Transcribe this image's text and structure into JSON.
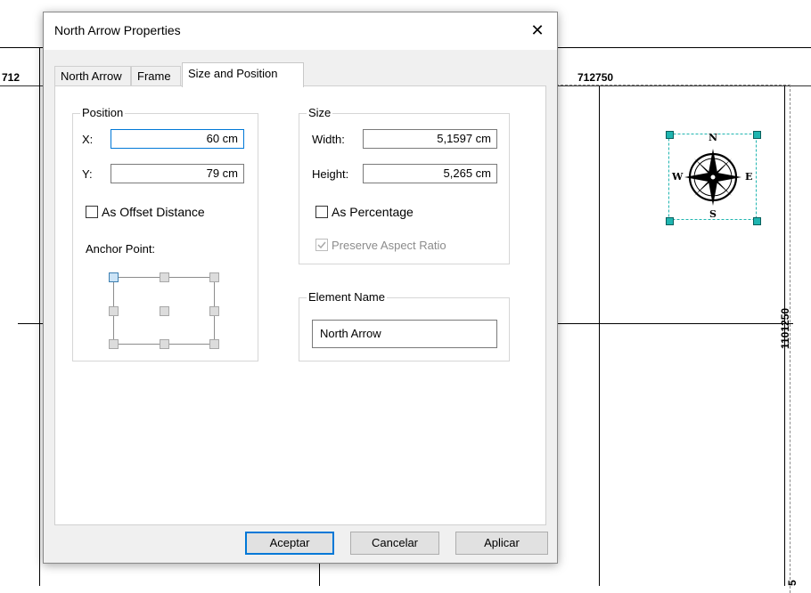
{
  "map": {
    "label_left": "712",
    "label_top": "712750",
    "label_right": "1101250",
    "label_bottom": "5"
  },
  "north_arrow_graphic": {
    "n": "N",
    "s": "S",
    "e": "E",
    "w": "W"
  },
  "dialog": {
    "title": "North Arrow Properties",
    "close_glyph": "✕",
    "tabs": [
      {
        "label": "North Arrow",
        "active": false
      },
      {
        "label": "Frame",
        "active": false
      },
      {
        "label": "Size and Position",
        "active": true
      }
    ],
    "position": {
      "group_label": "Position",
      "x_label": "X:",
      "x_value": "60 cm",
      "y_label": "Y:",
      "y_value": "79 cm",
      "offset_label": "As Offset Distance",
      "offset_checked": false,
      "anchor_label": "Anchor Point:"
    },
    "size": {
      "group_label": "Size",
      "width_label": "Width:",
      "width_value": "5,1597 cm",
      "height_label": "Height:",
      "height_value": "5,265 cm",
      "percentage_label": "As Percentage",
      "percentage_checked": false,
      "aspect_label": "Preserve Aspect Ratio",
      "aspect_checked": true
    },
    "element_name": {
      "group_label": "Element Name",
      "value": "North Arrow"
    },
    "buttons": {
      "ok": "Aceptar",
      "cancel": "Cancelar",
      "apply": "Aplicar"
    }
  },
  "colors": {
    "accent": "#0078d7",
    "handle": "#1fb5b0"
  }
}
